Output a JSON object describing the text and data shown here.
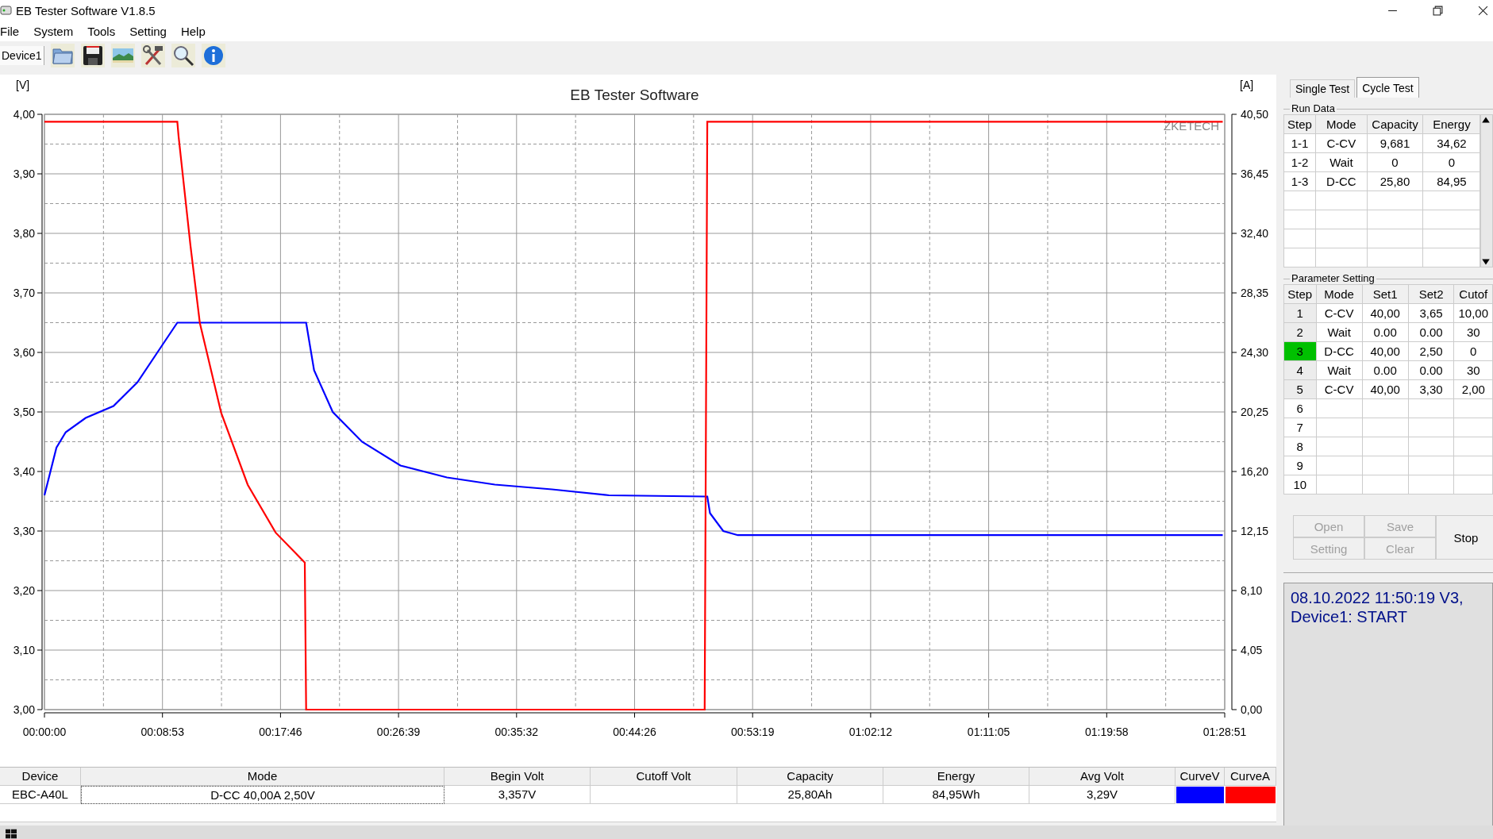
{
  "window": {
    "title": "EB Tester Software V1.8.5"
  },
  "menu": [
    "File",
    "System",
    "Tools",
    "Setting",
    "Help"
  ],
  "toolbar": {
    "device_tab": "Device1"
  },
  "chart": {
    "watermark_label": "ZKETECH",
    "chart_data": {
      "type": "line",
      "grid": true,
      "title": "EB Tester Software",
      "ylabel": "[V]",
      "y2label": "[A]",
      "y2lim": [
        0,
        40.5
      ],
      "y2ticks": [
        {
          "value": 0,
          "label": "0,00"
        },
        {
          "value": 4.05,
          "label": "4,05"
        },
        {
          "value": 8.1,
          "label": "8,10"
        },
        {
          "value": 12.15,
          "label": "12,15"
        },
        {
          "value": 16.2,
          "label": "16,20"
        },
        {
          "value": 20.25,
          "label": "20,25"
        },
        {
          "value": 24.3,
          "label": "24,30"
        },
        {
          "value": 28.35,
          "label": "28,35"
        },
        {
          "value": 32.4,
          "label": "32,40"
        },
        {
          "value": 36.45,
          "label": "36,45"
        },
        {
          "value": 40.5,
          "label": "40,50"
        }
      ],
      "x": [
        0,
        0.9,
        1.6,
        3.1,
        5.2,
        7,
        8.8,
        10,
        10.1,
        11,
        11.7,
        13.3,
        15.3,
        17.4,
        19.6,
        19.7,
        20.3,
        21.7,
        23.9,
        26.8,
        30.3,
        33.9,
        38.2,
        42.5,
        49.7,
        49.9,
        50.1,
        51.1,
        52.2,
        88.7
      ],
      "series": [
        {
          "color": "#0000ff",
          "values": [
            3.36,
            3.44,
            3.466,
            3.49,
            3.51,
            3.55,
            3.61,
            3.65,
            3.65,
            3.65,
            3.65,
            3.65,
            3.65,
            3.65,
            3.65,
            3.65,
            3.57,
            3.5,
            3.45,
            3.41,
            3.39,
            3.378,
            3.37,
            3.36,
            3.358,
            3.358,
            3.33,
            3.3,
            3.293,
            3.293
          ]
        },
        {
          "color": "#ff0000",
          "axis": "y2",
          "values": [
            40,
            40,
            40,
            40,
            40,
            40,
            40,
            40,
            39,
            31.5,
            26.3,
            20.2,
            15.3,
            12.05,
            10,
            0,
            0,
            0,
            0,
            0,
            0,
            0,
            0,
            0,
            0,
            40,
            40,
            40,
            40,
            40
          ]
        }
      ],
      "xlim": [
        0,
        88.85
      ],
      "ylim": [
        3,
        4
      ],
      "xticks": [
        {
          "value": 0,
          "label": "00:00:00"
        },
        {
          "value": 8.885,
          "label": "00:08:53"
        },
        {
          "value": 17.77,
          "label": "00:17:46"
        },
        {
          "value": 26.655,
          "label": "00:26:39"
        },
        {
          "value": 35.54,
          "label": "00:35:32"
        },
        {
          "value": 44.425,
          "label": "00:44:26"
        },
        {
          "value": 53.31,
          "label": "00:53:19"
        },
        {
          "value": 62.195,
          "label": "01:02:12"
        },
        {
          "value": 71.08,
          "label": "01:11:05"
        },
        {
          "value": 79.965,
          "label": "01:19:58"
        },
        {
          "value": 88.85,
          "label": "01:28:51"
        }
      ],
      "yticks": [
        {
          "value": 3,
          "label": "3,00"
        },
        {
          "value": 3.1,
          "label": "3,10"
        },
        {
          "value": 3.2,
          "label": "3,20"
        },
        {
          "value": 3.3,
          "label": "3,30"
        },
        {
          "value": 3.4,
          "label": "3,40"
        },
        {
          "value": 3.5,
          "label": "3,50"
        },
        {
          "value": 3.6,
          "label": "3,60"
        },
        {
          "value": 3.7,
          "label": "3,70"
        },
        {
          "value": 3.8,
          "label": "3,80"
        },
        {
          "value": 3.9,
          "label": "3,90"
        },
        {
          "value": 4,
          "label": "4,00"
        }
      ]
    }
  },
  "tabs": [
    {
      "label": "Single Test",
      "selected": false
    },
    {
      "label": "Cycle Test",
      "selected": true
    }
  ],
  "run_data": {
    "title": "Run Data",
    "columns": [
      "Step",
      "Mode",
      "Capacity",
      "Energy"
    ],
    "rows": [
      [
        "1-1",
        "C-CV",
        "9,681",
        "34,62"
      ],
      [
        "1-2",
        "Wait",
        "0",
        "0"
      ],
      [
        "1-3",
        "D-CC",
        "25,80",
        "84,95"
      ]
    ]
  },
  "parameter_setting": {
    "title": "Parameter Setting",
    "columns": [
      "Step",
      "Mode",
      "Set1",
      "Set2",
      "Cutof"
    ],
    "rows": [
      {
        "cells": [
          "1",
          "C-CV",
          "40,00",
          "3,65",
          "10,00"
        ],
        "selected": false
      },
      {
        "cells": [
          "2",
          "Wait",
          "0.00",
          "0.00",
          "30"
        ],
        "selected": false
      },
      {
        "cells": [
          "3",
          "D-CC",
          "40,00",
          "2,50",
          "0"
        ],
        "selected": true
      },
      {
        "cells": [
          "4",
          "Wait",
          "0.00",
          "0.00",
          "30"
        ],
        "selected": false
      },
      {
        "cells": [
          "5",
          "C-CV",
          "40,00",
          "3,30",
          "2,00"
        ],
        "selected": false
      },
      {
        "cells": [
          "6"
        ],
        "selected": false
      },
      {
        "cells": [
          "7"
        ],
        "selected": false
      },
      {
        "cells": [
          "8"
        ],
        "selected": false
      },
      {
        "cells": [
          "9"
        ],
        "selected": false
      },
      {
        "cells": [
          "10"
        ],
        "selected": false
      }
    ]
  },
  "buttons": [
    {
      "label": "Open",
      "disabled": true
    },
    {
      "label": "Save",
      "disabled": true
    },
    {
      "label": "Setting",
      "disabled": true
    },
    {
      "label": "Clear",
      "disabled": true
    },
    {
      "label": "Stop",
      "disabled": false
    }
  ],
  "log": [
    "08.10.2022 11:50:19 V3,",
    "Device1: START"
  ],
  "results": {
    "columns": [
      "Device",
      "Mode",
      "Begin Volt",
      "Cutoff Volt",
      "Capacity",
      "Energy",
      "Avg Volt",
      "CurveV",
      "CurveA"
    ],
    "rows": [
      {
        "cells": [
          "EBC-A40L",
          "D-CC  40,00A  2,50V",
          "3,357V",
          "",
          "25,80Ah",
          "84,95Wh",
          "3,29V"
        ],
        "curves": [
          {
            "color": "#0000ff"
          },
          {
            "color": "#ff0000"
          }
        ]
      }
    ]
  }
}
